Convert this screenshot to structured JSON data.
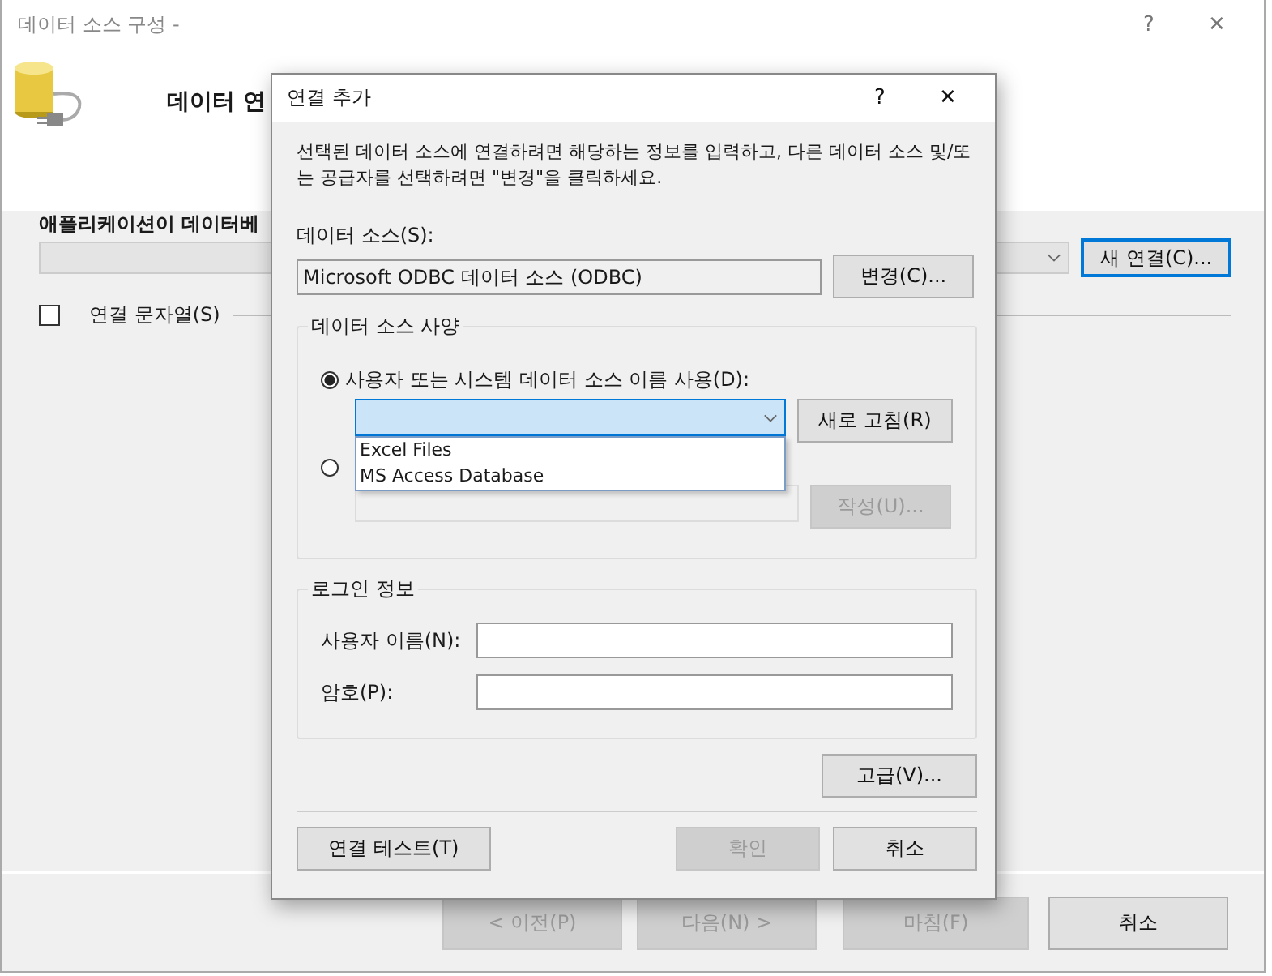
{
  "window": {
    "title": "데이터 소스 구성 -",
    "help": "?",
    "close": "✕"
  },
  "header": {
    "title": "데이터 연"
  },
  "body": {
    "prompt": "애플리케이션이 데이터베",
    "new_connection": "새 연결(C)...",
    "connection_string": {
      "label": "연결 문자열(S)",
      "checked": false
    }
  },
  "wizard_buttons": [
    {
      "label": "< 이전(P)",
      "disabled": true
    },
    {
      "label": "다음(N) >",
      "disabled": true
    },
    {
      "label": "마침(F)",
      "disabled": true
    },
    {
      "label": "취소",
      "disabled": false
    }
  ],
  "dialog": {
    "title": "연결 추가",
    "help": "?",
    "close": "✕",
    "description": "선택된 데이터 소스에 연결하려면 해당하는 정보를 입력하고, 다른 데이터 소스 및/또는 공급자를 선택하려면 \"변경\"을 클릭하세요.",
    "data_source_label": "데이터 소스(S):",
    "data_source_value": "Microsoft ODBC 데이터 소스 (ODBC)",
    "change_button": "변경(C)...",
    "spec_group": {
      "title": "데이터 소스 사양",
      "options": [
        {
          "label": "사용자 또는 시스템 데이터 소스 이름 사용(D):",
          "selected": true
        },
        {
          "selected": false
        }
      ],
      "dsn_items": [
        "Excel Files",
        "MS Access Database"
      ],
      "refresh_button": "새로 고침(R)",
      "build_button": {
        "label": "작성(U)...",
        "disabled": true
      }
    },
    "login_group": {
      "title": "로그인 정보",
      "fields": [
        {
          "label": "사용자 이름(N):"
        },
        {
          "label": "암호(P):"
        }
      ]
    },
    "advanced_button": "고급(V)...",
    "buttons": [
      {
        "label": "연결 테스트(T)",
        "disabled": false
      },
      {
        "label": "확인",
        "disabled": true
      },
      {
        "label": "취소",
        "disabled": false
      }
    ]
  }
}
